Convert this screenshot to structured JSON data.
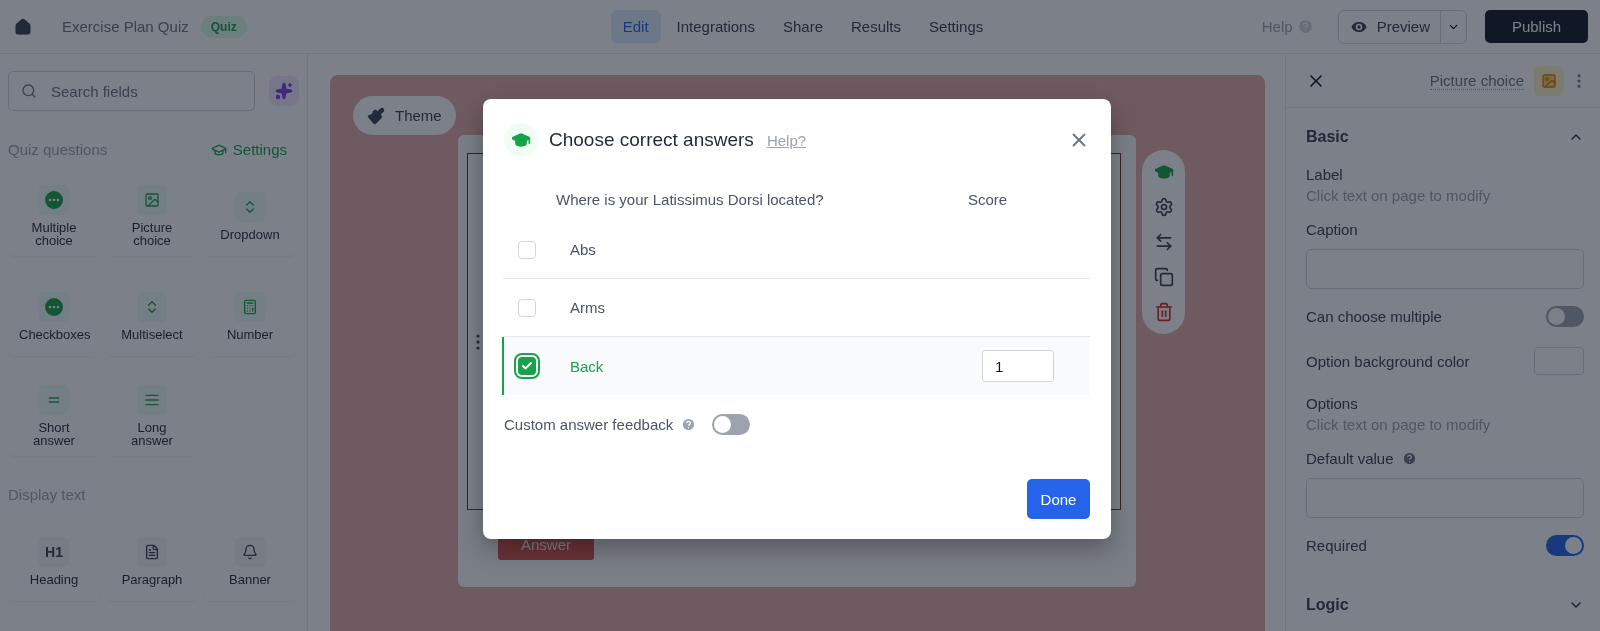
{
  "topbar": {
    "title": "Exercise Plan Quiz",
    "badge": "Quiz",
    "nav": [
      {
        "label": "Edit",
        "selected": true
      },
      {
        "label": "Integrations",
        "selected": false
      },
      {
        "label": "Share",
        "selected": false
      },
      {
        "label": "Results",
        "selected": false
      },
      {
        "label": "Settings",
        "selected": false
      }
    ],
    "help": "Help",
    "preview": "Preview",
    "publish": "Publish"
  },
  "sidebar": {
    "search": {
      "placeholder": "Search fields"
    },
    "sections": [
      {
        "title": "Quiz questions",
        "action": "Settings",
        "items": [
          {
            "label": "Multiple choice",
            "kind": "dots"
          },
          {
            "label": "Picture choice",
            "kind": "image"
          },
          {
            "label": "Dropdown",
            "kind": "updown"
          },
          {
            "label": "Checkboxes",
            "kind": "dots"
          },
          {
            "label": "Multiselect",
            "kind": "updown"
          },
          {
            "label": "Number",
            "kind": "calculator"
          },
          {
            "label": "Short answer",
            "kind": "short"
          },
          {
            "label": "Long answer",
            "kind": "long"
          }
        ]
      },
      {
        "title": "Display text",
        "items": [
          {
            "label": "Heading",
            "kind": "glyph",
            "glyph": "H1"
          },
          {
            "label": "Paragraph",
            "kind": "doc"
          },
          {
            "label": "Banner",
            "kind": "bell"
          }
        ]
      }
    ]
  },
  "canvas": {
    "theme_button": "Theme",
    "answer_button": "Answer"
  },
  "modal": {
    "title": "Choose correct answers",
    "help_link": "Help?",
    "question": "Where is your Latissimus Dorsi located?",
    "score_header": "Score",
    "options": [
      {
        "label": "Abs",
        "checked": false
      },
      {
        "label": "Arms",
        "checked": false
      },
      {
        "label": "Back",
        "checked": true,
        "score": "1"
      }
    ],
    "feedback": {
      "label": "Custom answer feedback",
      "on": false
    },
    "done": "Done"
  },
  "panel": {
    "field_type": "Picture choice",
    "sections": [
      {
        "title": "Basic",
        "expanded": true,
        "rows": [
          {
            "kind": "text",
            "label": "Label",
            "hint": "Click text on page to modify"
          },
          {
            "kind": "input",
            "label": "Caption"
          },
          {
            "kind": "toggle",
            "label": "Can choose multiple",
            "on": false
          },
          {
            "kind": "color",
            "label": "Option background color"
          },
          {
            "kind": "text",
            "label": "Options",
            "hint": "Click text on page to modify"
          },
          {
            "kind": "input",
            "label": "Default value",
            "help": true
          },
          {
            "kind": "toggle",
            "label": "Required",
            "on": true
          }
        ]
      },
      {
        "title": "Logic",
        "expanded": false
      }
    ]
  }
}
